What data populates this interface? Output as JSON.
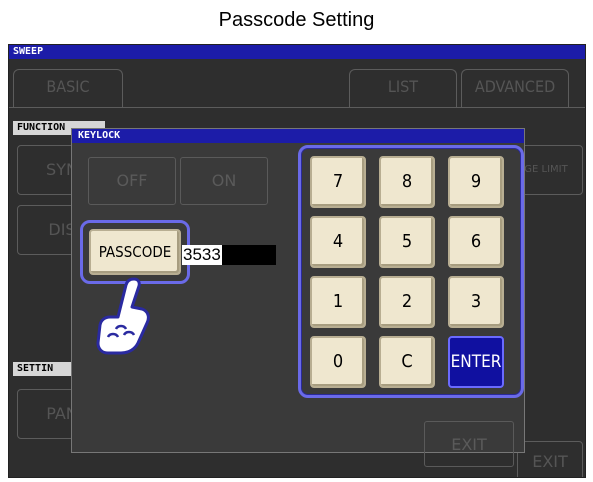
{
  "title": "Passcode Setting",
  "screen": {
    "header": "SWEEP",
    "tabs": {
      "basic": "BASIC",
      "list": "LIST",
      "advanced": "ADVANCED"
    },
    "function_label": "FUNCTION",
    "bg_buttons": {
      "syn": "SYN",
      "dis": "DIS",
      "ge_limit": "GE LIMIT",
      "pan": "PAN",
      "exit": "EXIT"
    },
    "setting_label": "SETTIN"
  },
  "dialog": {
    "title": "KEYLOCK",
    "off_label": "OFF",
    "on_label": "ON",
    "passcode_label": "PASSCODE",
    "passcode_value": "3533",
    "exit_label": "EXIT",
    "keys": [
      "7",
      "8",
      "9",
      "4",
      "5",
      "6",
      "1",
      "2",
      "3",
      "0",
      "C",
      "ENTER"
    ]
  },
  "colors": {
    "accent": "#1c1ca8",
    "highlight_frame": "#6a6ae8",
    "key_face": "#efe7cf"
  }
}
